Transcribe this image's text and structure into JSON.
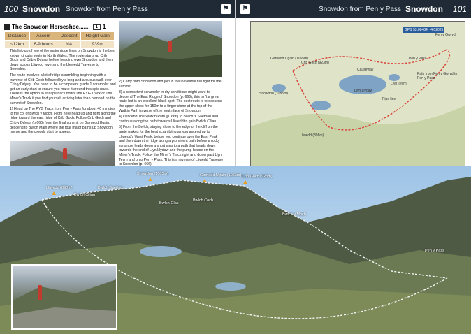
{
  "left_page": {
    "page_number": "100",
    "title": "Snowdon",
    "subtitle": "Snowdon from Pen y Pass"
  },
  "right_page": {
    "page_number": "101",
    "title": "Snowdon",
    "subtitle": "Snowdon from Pen y Pass"
  },
  "route": {
    "name": "The Snowdon Horseshoe.......",
    "grade_label": "1",
    "grade_num": "1",
    "stats": {
      "headers": [
        "Distance",
        "Ascent",
        "Descent",
        "Height Gain"
      ],
      "values": [
        "~12km",
        "6-9 hours",
        "NA",
        "939m"
      ]
    }
  },
  "intro_text": [
    "This link-up of two of the major ridge lines on Snowdon is the best known circular route in North Wales. The route starts up Crib Goch and Crib y Ddysgl before heading over Snowdon and then down across Lliwedd reversing the Llewedd Traverse to Snowdon.",
    "The route involves a lot of ridge scrambling beginning with a traverse of Crib Goch followed by a long and arduous walk over Crib y Ddysgl. You need to be a competent grade 1 scrambler and get an early start to ensure you make it around this epic route. There is the option to escape back down The PYG Track or The Miner's Track if you find yourself arriving later than planned on the summit of Snowdon.",
    "1) Head up The PYG Track from Pen y Pass for about 40 minutes to the col of Bwlch y Moch. From here head up and right along the ridge toward the east ridge of Crib Goch. Follow Crib Goch and Crib y Ddysgl (p.666) from the final summit on Garnedd Ugain, descend to Bwlch Main where the four major paths up Snowdon merge and the crowds start to appear."
  ],
  "middle_text": [
    "2) Carry onto Snowdon and join in the inevitable fun fight for the summit.",
    "3) A competent scrambler in dry conditions might want to descend The East Ridge of Snowdon (p. 666), this isn't a great route but is an excellent black spot! The best route is to descend the upper slope for 150m to a finger stone at the top of the Watkin Path traverse of the south face of Snowdon.",
    "4) Descend The Watkin Path (p. 666) to Bwlch Y Saethau and continue along the path towards Lliwedd to gain Bwlch Ciliau.",
    "5) From the Bwlch, staying close to the edge of the cliff on the arete makes for the best scrambling as you ascend up to Lliwedd's West Peak, before you continue over the East Peak and then down the ridge along a prominent path before a rocky scramble leads down a short step to a path that heads down towards the end of Llyn Llydaw and the pump-house on the Miner's Track. Follow the Miner's Track right and down past Llyn Teyrn and onto Pen y Pass. This is a reverse of Lliwedd Traverse to Snowdon (p. 666)."
  ],
  "panorama_labels": {
    "snowdon": "Snowdon (1085m)",
    "garnedd": "Garnedd Ugain (1065m)",
    "crib_goch": "Crib Goch (923m)",
    "lliwedd": "Lliwedd (898m)",
    "bwlch_ciliau": "Bwlch Ciliau",
    "bwlch_saethau": "Bwlch Saethau",
    "bwlch_glas": "Bwlch Glas",
    "bwlch_coch": "Bwlch Coch",
    "bwlch_y_moch": "Bwlch y Moch",
    "pen_y_pass": "Pen y Pass"
  },
  "map_labels": {
    "gps": "GPS 53.08484, -4.02025",
    "pen_y_gwryd": "Pen y Gwryd",
    "garnedd": "Garnedd Ugain (1065m)",
    "crib_goch": "Crib Goch (923m)",
    "snowdon": "Snowdon (1085m)",
    "lliwedd": "Lliwedd (898m)",
    "llyn_llydaw": "Llyn Llydaw",
    "causeway": "Causeway",
    "llyn_teyrn": "Llyn Teyrn",
    "pen_y_pass": "Pen y Pass",
    "path_note": "Path from Pen y Gwryd to Pen y Pass",
    "pipe_line": "Pipe line"
  },
  "colors": {
    "header_bg": "#1f2a36",
    "table_header": "#d9b47b",
    "table_cell": "#f2e3c6",
    "route_line": "#d9453a",
    "peak_marker": "#e7a12b"
  }
}
